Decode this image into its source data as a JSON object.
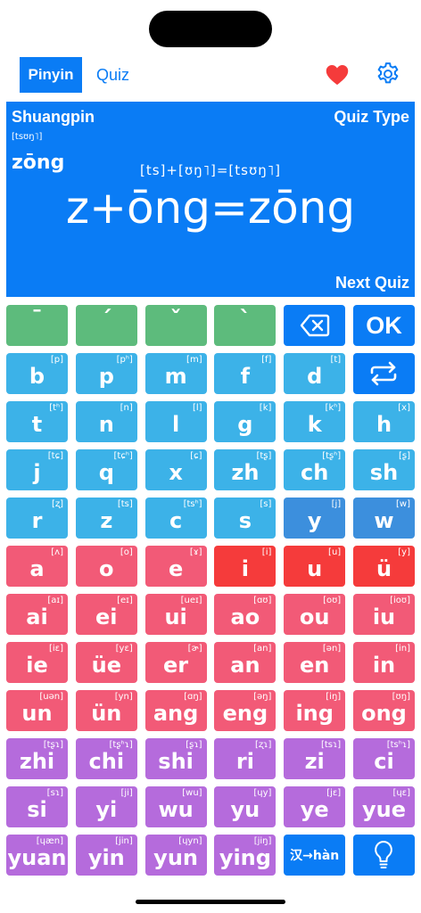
{
  "tabs": {
    "pinyin": "Pinyin",
    "quiz": "Quiz"
  },
  "panel": {
    "mode": "Shuangpin",
    "ipa_small": "[tsʊŋ˥]",
    "syllable": "zōng",
    "quiz_type": "Quiz Type",
    "ipa_equation": "[ts]+[ʊŋ˥]=[tsʊŋ˥]",
    "equation": "z+ōng=zōng",
    "next_quiz": "Next Quiz"
  },
  "colors": {
    "accent": "#0a7cf5",
    "tone": "#5dbb7c",
    "initial": "#3cb2e8",
    "semivowel": "#3c8fdd",
    "final": "#f25a77",
    "vowel": "#f53b3b",
    "whole": "#b56bdc",
    "heart": "#f53b3b"
  },
  "keyboard": {
    "rows": [
      [
        {
          "label": "ˉ",
          "ipa": "",
          "name": "key-tone-1",
          "cls": "k-green k-tone"
        },
        {
          "label": "ˊ",
          "ipa": "",
          "name": "key-tone-2",
          "cls": "k-green k-tone"
        },
        {
          "label": "ˇ",
          "ipa": "",
          "name": "key-tone-3",
          "cls": "k-green k-tone"
        },
        {
          "label": "ˋ",
          "ipa": "",
          "name": "key-tone-4",
          "cls": "k-green k-tone"
        },
        {
          "label": "",
          "ipa": "",
          "name": "backspace-button",
          "cls": "k-blue",
          "icon": "backspace-icon"
        },
        {
          "label": "OK",
          "ipa": "",
          "name": "ok-button",
          "cls": "k-blue k-ok"
        }
      ],
      [
        {
          "label": "b",
          "ipa": "[p]",
          "name": "key-b",
          "cls": "k-cyan"
        },
        {
          "label": "p",
          "ipa": "[pʰ]",
          "name": "key-p",
          "cls": "k-cyan"
        },
        {
          "label": "m",
          "ipa": "[m]",
          "name": "key-m",
          "cls": "k-cyan"
        },
        {
          "label": "f",
          "ipa": "[f]",
          "name": "key-f",
          "cls": "k-cyan"
        },
        {
          "label": "d",
          "ipa": "[t]",
          "name": "key-d",
          "cls": "k-cyan"
        },
        {
          "label": "",
          "ipa": "",
          "name": "swap-button",
          "cls": "k-blue",
          "icon": "repeat-icon"
        }
      ],
      [
        {
          "label": "t",
          "ipa": "[tʰ]",
          "name": "key-t",
          "cls": "k-cyan"
        },
        {
          "label": "n",
          "ipa": "[n]",
          "name": "key-n",
          "cls": "k-cyan"
        },
        {
          "label": "l",
          "ipa": "[l]",
          "name": "key-l",
          "cls": "k-cyan"
        },
        {
          "label": "g",
          "ipa": "[k]",
          "name": "key-g",
          "cls": "k-cyan"
        },
        {
          "label": "k",
          "ipa": "[kʰ]",
          "name": "key-k",
          "cls": "k-cyan"
        },
        {
          "label": "h",
          "ipa": "[x]",
          "name": "key-h",
          "cls": "k-cyan"
        }
      ],
      [
        {
          "label": "j",
          "ipa": "[tɕ]",
          "name": "key-j",
          "cls": "k-cyan"
        },
        {
          "label": "q",
          "ipa": "[tɕʰ]",
          "name": "key-q",
          "cls": "k-cyan"
        },
        {
          "label": "x",
          "ipa": "[ɕ]",
          "name": "key-x",
          "cls": "k-cyan"
        },
        {
          "label": "zh",
          "ipa": "[tʂ]",
          "name": "key-zh",
          "cls": "k-cyan"
        },
        {
          "label": "ch",
          "ipa": "[tʂʰ]",
          "name": "key-ch",
          "cls": "k-cyan"
        },
        {
          "label": "sh",
          "ipa": "[ʂ]",
          "name": "key-sh",
          "cls": "k-cyan"
        }
      ],
      [
        {
          "label": "r",
          "ipa": "[ʐ]",
          "name": "key-r",
          "cls": "k-cyan"
        },
        {
          "label": "z",
          "ipa": "[ts]",
          "name": "key-z",
          "cls": "k-cyan"
        },
        {
          "label": "c",
          "ipa": "[tsʰ]",
          "name": "key-c",
          "cls": "k-cyan"
        },
        {
          "label": "s",
          "ipa": "[s]",
          "name": "key-s",
          "cls": "k-cyan"
        },
        {
          "label": "y",
          "ipa": "[j]",
          "name": "key-y",
          "cls": "k-steel"
        },
        {
          "label": "w",
          "ipa": "[w]",
          "name": "key-w",
          "cls": "k-steel"
        }
      ],
      [
        {
          "label": "a",
          "ipa": "[ʌ]",
          "name": "key-a",
          "cls": "k-pink"
        },
        {
          "label": "o",
          "ipa": "[o]",
          "name": "key-o",
          "cls": "k-pink"
        },
        {
          "label": "e",
          "ipa": "[ɤ]",
          "name": "key-e",
          "cls": "k-pink"
        },
        {
          "label": "i",
          "ipa": "[i]",
          "name": "key-i",
          "cls": "k-red"
        },
        {
          "label": "u",
          "ipa": "[u]",
          "name": "key-u",
          "cls": "k-red"
        },
        {
          "label": "ü",
          "ipa": "[y]",
          "name": "key-v",
          "cls": "k-red"
        }
      ],
      [
        {
          "label": "ai",
          "ipa": "[aɪ]",
          "name": "key-ai",
          "cls": "k-pink"
        },
        {
          "label": "ei",
          "ipa": "[eɪ]",
          "name": "key-ei",
          "cls": "k-pink"
        },
        {
          "label": "ui",
          "ipa": "[ueɪ]",
          "name": "key-ui",
          "cls": "k-pink"
        },
        {
          "label": "ao",
          "ipa": "[ɑʊ]",
          "name": "key-ao",
          "cls": "k-pink"
        },
        {
          "label": "ou",
          "ipa": "[oʊ]",
          "name": "key-ou",
          "cls": "k-pink"
        },
        {
          "label": "iu",
          "ipa": "[ioʊ]",
          "name": "key-iu",
          "cls": "k-pink"
        }
      ],
      [
        {
          "label": "ie",
          "ipa": "[iɛ]",
          "name": "key-ie",
          "cls": "k-pink"
        },
        {
          "label": "üe",
          "ipa": "[yɛ]",
          "name": "key-ve",
          "cls": "k-pink"
        },
        {
          "label": "er",
          "ipa": "[ɚ]",
          "name": "key-er",
          "cls": "k-pink"
        },
        {
          "label": "an",
          "ipa": "[an]",
          "name": "key-an",
          "cls": "k-pink"
        },
        {
          "label": "en",
          "ipa": "[ən]",
          "name": "key-en",
          "cls": "k-pink"
        },
        {
          "label": "in",
          "ipa": "[in]",
          "name": "key-in",
          "cls": "k-pink"
        }
      ],
      [
        {
          "label": "un",
          "ipa": "[uən]",
          "name": "key-un",
          "cls": "k-pink"
        },
        {
          "label": "ün",
          "ipa": "[yn]",
          "name": "key-vn",
          "cls": "k-pink"
        },
        {
          "label": "ang",
          "ipa": "[ɑŋ]",
          "name": "key-ang",
          "cls": "k-pink"
        },
        {
          "label": "eng",
          "ipa": "[əŋ]",
          "name": "key-eng",
          "cls": "k-pink"
        },
        {
          "label": "ing",
          "ipa": "[iŋ]",
          "name": "key-ing",
          "cls": "k-pink"
        },
        {
          "label": "ong",
          "ipa": "[ʊŋ]",
          "name": "key-ong",
          "cls": "k-pink"
        }
      ],
      [
        {
          "label": "zhi",
          "ipa": "[tʂɿ]",
          "name": "key-zhi",
          "cls": "k-purple"
        },
        {
          "label": "chi",
          "ipa": "[tʂʰɿ]",
          "name": "key-chi",
          "cls": "k-purple"
        },
        {
          "label": "shi",
          "ipa": "[ʂɿ]",
          "name": "key-shi",
          "cls": "k-purple"
        },
        {
          "label": "ri",
          "ipa": "[ʐɿ]",
          "name": "key-ri",
          "cls": "k-purple"
        },
        {
          "label": "zi",
          "ipa": "[tsɿ]",
          "name": "key-zi",
          "cls": "k-purple"
        },
        {
          "label": "ci",
          "ipa": "[tsʰɿ]",
          "name": "key-ci",
          "cls": "k-purple"
        }
      ],
      [
        {
          "label": "si",
          "ipa": "[sɿ]",
          "name": "key-si",
          "cls": "k-purple"
        },
        {
          "label": "yi",
          "ipa": "[ji]",
          "name": "key-yi",
          "cls": "k-purple"
        },
        {
          "label": "wu",
          "ipa": "[wu]",
          "name": "key-wu",
          "cls": "k-purple"
        },
        {
          "label": "yu",
          "ipa": "[ɥy]",
          "name": "key-yu",
          "cls": "k-purple"
        },
        {
          "label": "ye",
          "ipa": "[jɛ]",
          "name": "key-ye",
          "cls": "k-purple"
        },
        {
          "label": "yue",
          "ipa": "[ɥɛ]",
          "name": "key-yue",
          "cls": "k-purple"
        }
      ],
      [
        {
          "label": "yuan",
          "ipa": "[ɥæn]",
          "name": "key-yuan",
          "cls": "k-purple"
        },
        {
          "label": "yin",
          "ipa": "[jin]",
          "name": "key-yin",
          "cls": "k-purple"
        },
        {
          "label": "yun",
          "ipa": "[ɥyn]",
          "name": "key-yun",
          "cls": "k-purple"
        },
        {
          "label": "ying",
          "ipa": "[jiŋ]",
          "name": "key-ying",
          "cls": "k-purple"
        },
        {
          "label": "汉→hàn",
          "ipa": "",
          "name": "hanzi-convert-button",
          "cls": "k-blue k-han"
        },
        {
          "label": "",
          "ipa": "",
          "name": "hint-button",
          "cls": "k-blue",
          "icon": "lightbulb-icon"
        }
      ]
    ]
  }
}
